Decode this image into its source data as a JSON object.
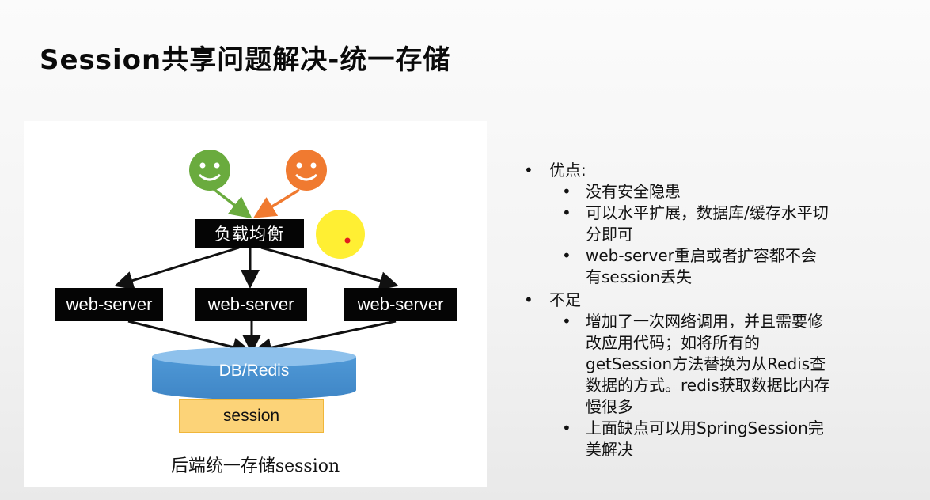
{
  "title": "Session共享问题解决-统一存储",
  "diagram": {
    "load_balancer": "负载均衡",
    "web_servers": [
      "web-server",
      "web-server",
      "web-server"
    ],
    "database": "DB/Redis",
    "session": "session",
    "caption": "后端统一存储session",
    "colors": {
      "user_left": "#6aab3e",
      "user_right": "#f07a30",
      "database": "#4b93d1",
      "session": "#fcd378",
      "highlight": "#ffee22",
      "pointer": "#e21d1d"
    }
  },
  "bullets": [
    {
      "label": "优点:",
      "items": [
        "没有安全隐患",
        "可以水平扩展，数据库/缓存水平切分即可",
        "web-server重启或者扩容都不会有session丢失"
      ]
    },
    {
      "label": "不足",
      "items": [
        "增加了一次网络调用，并且需要修改应用代码；如将所有的getSession方法替换为从Redis查数据的方式。redis获取数据比内存慢很多",
        "上面缺点可以用SpringSession完美解决"
      ]
    }
  ]
}
